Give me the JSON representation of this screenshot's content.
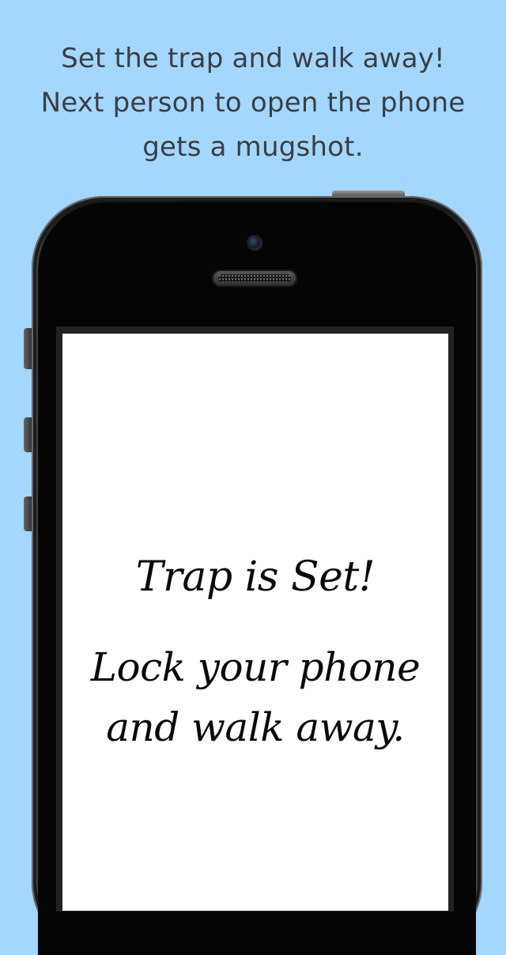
{
  "headline": {
    "line1": "Set the trap and walk away!",
    "line2": "Next person to open the phone",
    "line3": "gets a mugshot."
  },
  "screen": {
    "title": "Trap is Set!",
    "body_line1": "Lock your phone",
    "body_line2": "and walk away."
  },
  "colors": {
    "background": "#a3d7fe",
    "headline_text": "#3a3f44",
    "screen_background": "#ffffff",
    "screen_text": "#0a0a0a",
    "device_body": "#0f0f0f"
  },
  "icons": [
    "front-camera-icon",
    "speaker-grill-icon"
  ]
}
